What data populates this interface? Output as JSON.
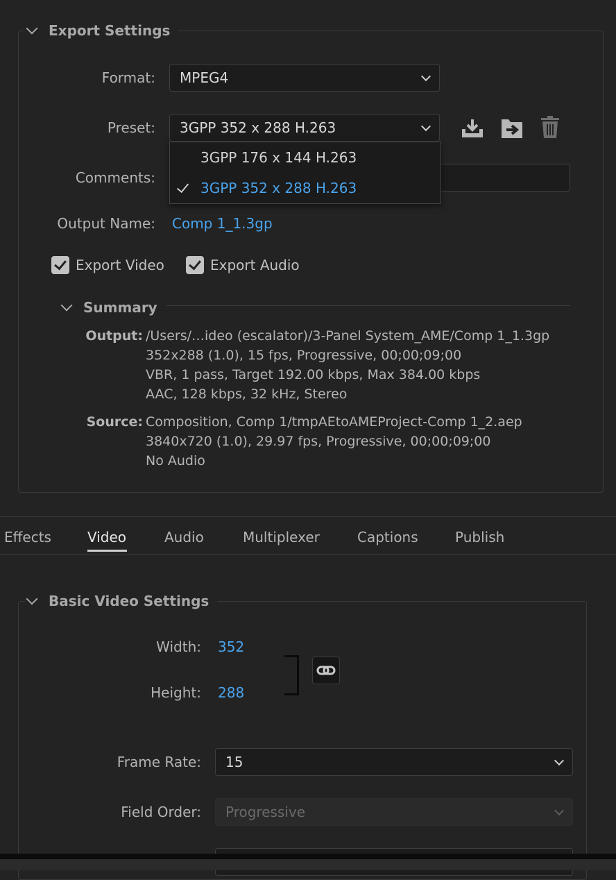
{
  "export_settings": {
    "title": "Export Settings",
    "format": {
      "label": "Format:",
      "value": "MPEG4"
    },
    "preset": {
      "label": "Preset:",
      "value": "3GPP 352 x 288 H.263",
      "options": [
        "3GPP 176 x 144 H.263",
        "3GPP 352 x 288 H.263"
      ],
      "selected_index": 1
    },
    "comments": {
      "label": "Comments:",
      "value": ""
    },
    "output_name": {
      "label": "Output Name:",
      "value": "Comp 1_1.3gp"
    },
    "export_video": {
      "label": "Export Video",
      "checked": true
    },
    "export_audio": {
      "label": "Export Audio",
      "checked": true
    },
    "icons": [
      "save-preset-icon",
      "import-preset-icon",
      "delete-preset-icon"
    ],
    "summary": {
      "title": "Summary",
      "output_label": "Output:",
      "output_lines": [
        "/Users/…ideo (escalator)/3-Panel System_AME/Comp 1_1.3gp",
        "352x288 (1.0), 15 fps, Progressive, 00;00;09;00",
        "VBR, 1 pass, Target 192.00 kbps, Max 384.00 kbps",
        "AAC, 128 kbps, 32 kHz, Stereo"
      ],
      "source_label": "Source:",
      "source_lines": [
        "Composition, Comp 1/tmpAEtoAMEProject-Comp 1_2.aep",
        "3840x720 (1.0), 29.97 fps, Progressive, 00;00;09;00",
        "No Audio"
      ]
    }
  },
  "tabs": {
    "items": [
      "Effects",
      "Video",
      "Audio",
      "Multiplexer",
      "Captions",
      "Publish"
    ],
    "active": "Video"
  },
  "video_settings": {
    "title": "Basic Video Settings",
    "width": {
      "label": "Width:",
      "value": "352"
    },
    "height": {
      "label": "Height:",
      "value": "288"
    },
    "frame_rate": {
      "label": "Frame Rate:",
      "value": "15"
    },
    "field_order": {
      "label": "Field Order:",
      "value": "Progressive"
    },
    "link_icon": "link-icon"
  },
  "colors": {
    "accent": "#4aa3ec",
    "background": "#232323"
  }
}
